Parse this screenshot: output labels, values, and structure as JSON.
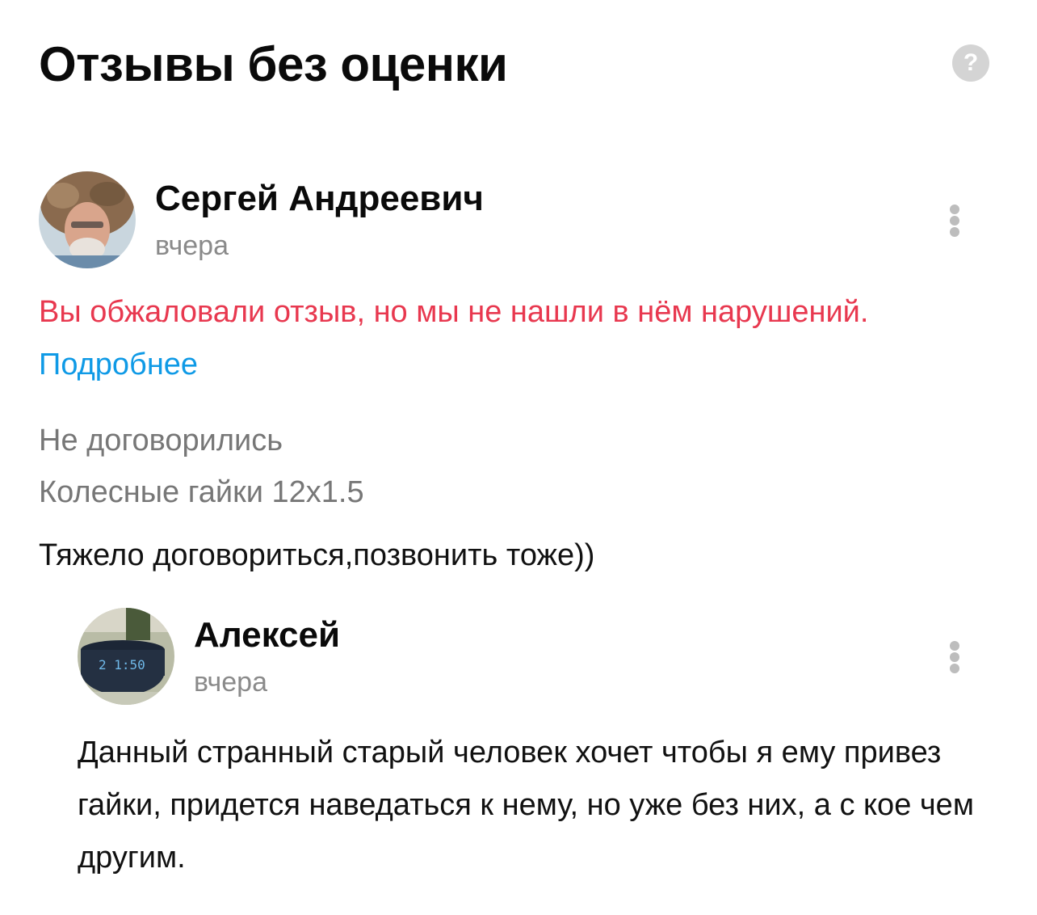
{
  "header": {
    "title": "Отзывы без оценки",
    "help_icon": "question-icon",
    "help_label": "?"
  },
  "review": {
    "author": "Сергей Андреевич",
    "date": "вчера",
    "notice_text": "Вы обжаловали отзыв, но мы не нашли в нём нарушений.",
    "notice_link": "Подробнее",
    "deal_status": "Не договорились",
    "item": "Колесные гайки 12x1.5",
    "text": "Тяжело договориться,позвонить тоже))",
    "menu_icon": "more-vertical-icon"
  },
  "reply": {
    "author": "Алексей",
    "date": "вчера",
    "text": "Данный странный старый человек хочет чтобы я ему привез гайки, придется наведаться к нему, но уже без них, а с кое чем другим.",
    "menu_icon": "more-vertical-icon"
  },
  "colors": {
    "notice": "#e8384f",
    "link": "#0f9ae6",
    "secondary": "#8a8a8a",
    "dots": "#bdbdbd"
  }
}
